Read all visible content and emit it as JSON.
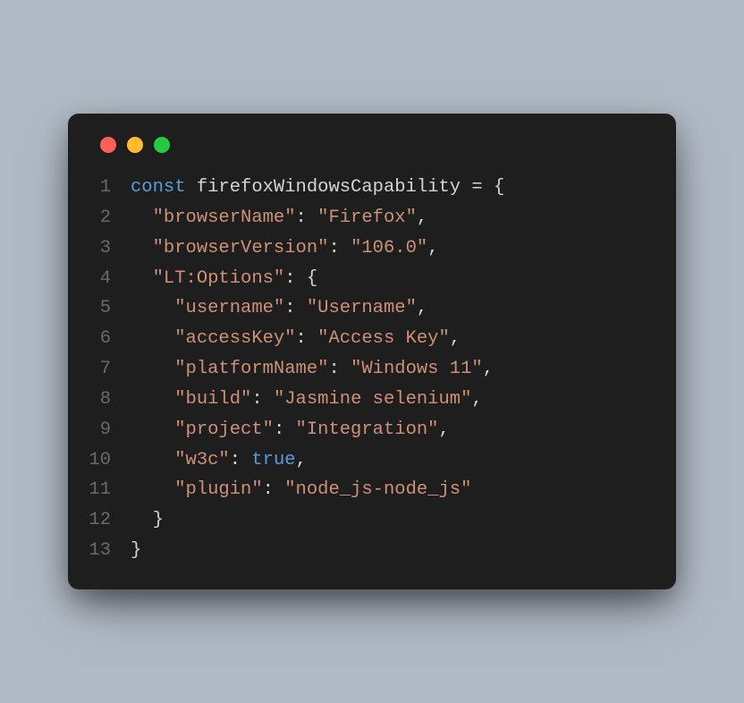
{
  "editor": {
    "dots": [
      "red",
      "yellow",
      "green"
    ],
    "lines": [
      {
        "num": "1",
        "tokens": [
          {
            "cls": "kw",
            "t": "const"
          },
          {
            "cls": "var",
            "t": " firefoxWindowsCapability "
          },
          {
            "cls": "op",
            "t": "="
          },
          {
            "cls": "punct",
            "t": " {"
          }
        ]
      },
      {
        "num": "2",
        "tokens": [
          {
            "cls": "punct",
            "t": "  "
          },
          {
            "cls": "str",
            "t": "\"browserName\""
          },
          {
            "cls": "punct",
            "t": ": "
          },
          {
            "cls": "str",
            "t": "\"Firefox\""
          },
          {
            "cls": "punct",
            "t": ","
          }
        ]
      },
      {
        "num": "3",
        "tokens": [
          {
            "cls": "punct",
            "t": "  "
          },
          {
            "cls": "str",
            "t": "\"browserVersion\""
          },
          {
            "cls": "punct",
            "t": ": "
          },
          {
            "cls": "str",
            "t": "\"106.0\""
          },
          {
            "cls": "punct",
            "t": ","
          }
        ]
      },
      {
        "num": "4",
        "tokens": [
          {
            "cls": "punct",
            "t": "  "
          },
          {
            "cls": "str",
            "t": "\"LT:Options\""
          },
          {
            "cls": "punct",
            "t": ": {"
          }
        ]
      },
      {
        "num": "5",
        "tokens": [
          {
            "cls": "punct",
            "t": "    "
          },
          {
            "cls": "str",
            "t": "\"username\""
          },
          {
            "cls": "punct",
            "t": ": "
          },
          {
            "cls": "str",
            "t": "\"Username\""
          },
          {
            "cls": "punct",
            "t": ","
          }
        ]
      },
      {
        "num": "6",
        "tokens": [
          {
            "cls": "punct",
            "t": "    "
          },
          {
            "cls": "str",
            "t": "\"accessKey\""
          },
          {
            "cls": "punct",
            "t": ": "
          },
          {
            "cls": "str",
            "t": "\"Access Key\""
          },
          {
            "cls": "punct",
            "t": ","
          }
        ]
      },
      {
        "num": "7",
        "tokens": [
          {
            "cls": "punct",
            "t": "    "
          },
          {
            "cls": "str",
            "t": "\"platformName\""
          },
          {
            "cls": "punct",
            "t": ": "
          },
          {
            "cls": "str",
            "t": "\"Windows 11\""
          },
          {
            "cls": "punct",
            "t": ","
          }
        ]
      },
      {
        "num": "8",
        "tokens": [
          {
            "cls": "punct",
            "t": "    "
          },
          {
            "cls": "str",
            "t": "\"build\""
          },
          {
            "cls": "punct",
            "t": ": "
          },
          {
            "cls": "str",
            "t": "\"Jasmine selenium\""
          },
          {
            "cls": "punct",
            "t": ","
          }
        ]
      },
      {
        "num": "9",
        "tokens": [
          {
            "cls": "punct",
            "t": "    "
          },
          {
            "cls": "str",
            "t": "\"project\""
          },
          {
            "cls": "punct",
            "t": ": "
          },
          {
            "cls": "str",
            "t": "\"Integration\""
          },
          {
            "cls": "punct",
            "t": ","
          }
        ]
      },
      {
        "num": "10",
        "tokens": [
          {
            "cls": "punct",
            "t": "    "
          },
          {
            "cls": "str",
            "t": "\"w3c\""
          },
          {
            "cls": "punct",
            "t": ": "
          },
          {
            "cls": "bool",
            "t": "true"
          },
          {
            "cls": "punct",
            "t": ","
          }
        ]
      },
      {
        "num": "11",
        "tokens": [
          {
            "cls": "punct",
            "t": "    "
          },
          {
            "cls": "str",
            "t": "\"plugin\""
          },
          {
            "cls": "punct",
            "t": ": "
          },
          {
            "cls": "str",
            "t": "\"node_js-node_js\""
          }
        ]
      },
      {
        "num": "12",
        "tokens": [
          {
            "cls": "punct",
            "t": "  }"
          }
        ]
      },
      {
        "num": "13",
        "tokens": [
          {
            "cls": "punct",
            "t": "}"
          }
        ]
      }
    ]
  }
}
